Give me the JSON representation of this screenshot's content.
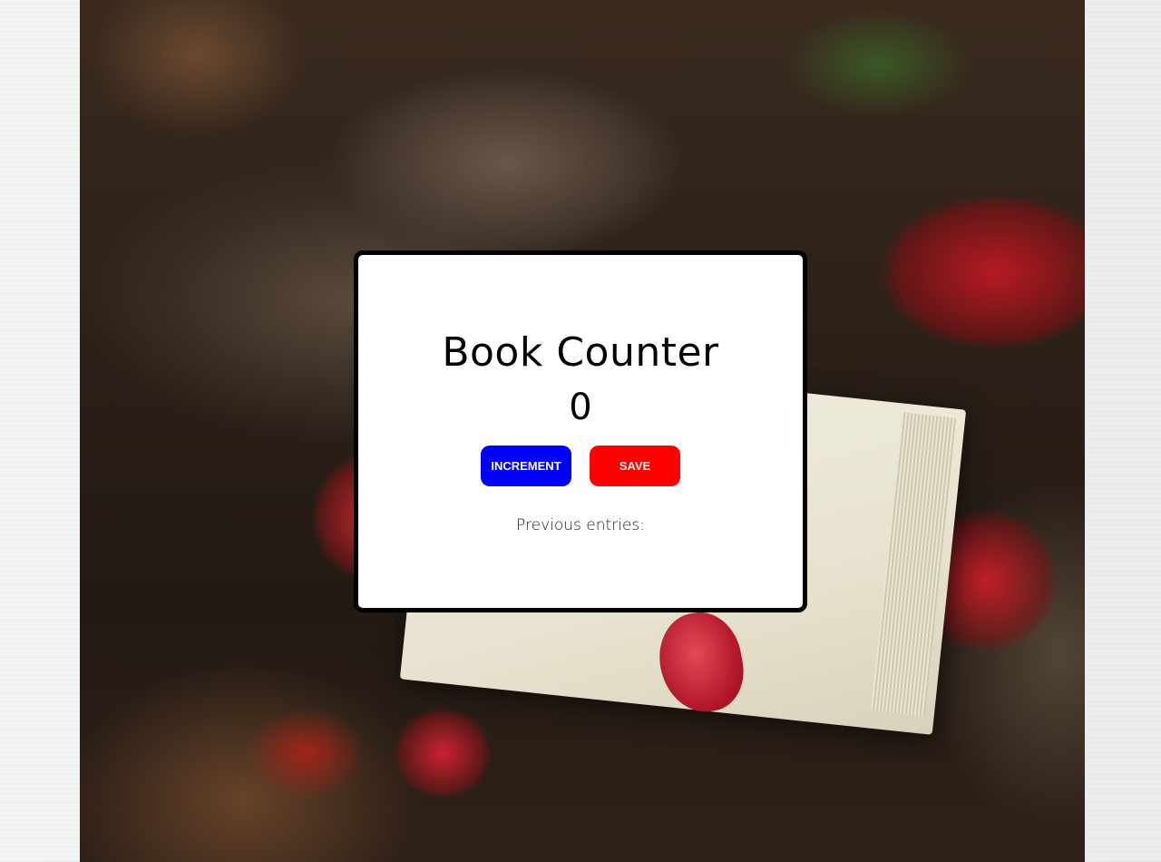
{
  "app": {
    "title": "Book Counter",
    "count": "0"
  },
  "buttons": {
    "increment_label": "INCREMENT",
    "save_label": "SAVE"
  },
  "entries": {
    "label": "Previous entries:",
    "items": []
  },
  "colors": {
    "increment": "#0000ff",
    "save": "#ff0000",
    "card_border": "#000000",
    "card_bg": "#ffffff"
  }
}
